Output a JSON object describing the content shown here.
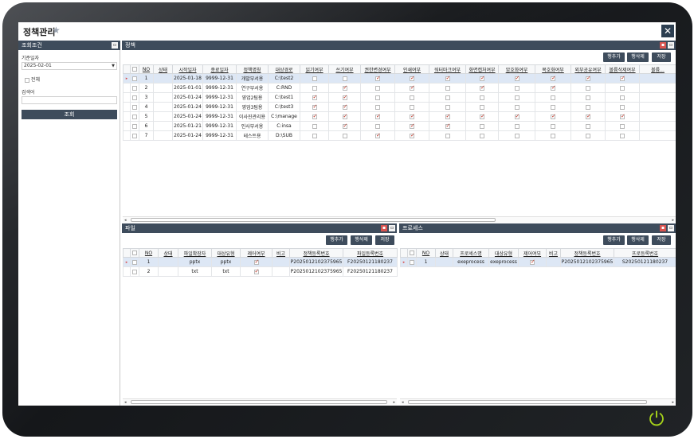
{
  "window": {
    "title": "정책관리",
    "close_label": "✕"
  },
  "left_panel": {
    "header": "조회조건",
    "base_date_label": "기준일자",
    "base_date_value": "2025-02-01",
    "all_label": "전체",
    "search_label": "검색어",
    "search_value": "",
    "search_button": "조회"
  },
  "policy_panel": {
    "header": "정책",
    "buttons": [
      "행추가",
      "행삭제",
      "저장"
    ],
    "columns": [
      "NO",
      "상태",
      "시작일자",
      "종료일자",
      "정책명칭",
      "대상경로",
      "읽기여부",
      "쓰기여부",
      "권한변경여부",
      "인쇄여부",
      "워터마크여부",
      "화면캡처여부",
      "암호화여부",
      "복호화여부",
      "외부공유여부",
      "볼륨삭제여부",
      "볼륨..."
    ],
    "rows": [
      {
        "no": "1",
        "start": "2025-01-18",
        "end": "9999-12-31",
        "name": "개발부서용",
        "path": "C:\\test2",
        "checks": [
          0,
          0,
          1,
          1,
          1,
          1,
          1,
          1,
          1,
          1
        ]
      },
      {
        "no": "2",
        "start": "2025-01-01",
        "end": "9999-12-31",
        "name": "연구부서용",
        "path": "C:RND",
        "checks": [
          0,
          1,
          0,
          1,
          0,
          1,
          0,
          1,
          0,
          0
        ]
      },
      {
        "no": "3",
        "start": "2025-01-24",
        "end": "9999-12-31",
        "name": "영업2팀용",
        "path": "C:\\test1",
        "checks": [
          1,
          1,
          0,
          0,
          0,
          0,
          0,
          0,
          0,
          0
        ]
      },
      {
        "no": "4",
        "start": "2025-01-24",
        "end": "9999-12-31",
        "name": "영업3팀용",
        "path": "C:\\test3",
        "checks": [
          1,
          1,
          0,
          0,
          0,
          0,
          0,
          0,
          0,
          0
        ]
      },
      {
        "no": "5",
        "start": "2025-01-24",
        "end": "9999-12-31",
        "name": "이사진관리용",
        "path": "C:\\manage",
        "checks": [
          1,
          1,
          1,
          1,
          1,
          1,
          1,
          1,
          1,
          1
        ]
      },
      {
        "no": "6",
        "start": "2025-01-21",
        "end": "9999-12-31",
        "name": "인사부서용",
        "path": "C:insa",
        "checks": [
          0,
          1,
          0,
          1,
          1,
          0,
          0,
          0,
          0,
          0
        ]
      },
      {
        "no": "7",
        "start": "2025-01-24",
        "end": "9999-12-31",
        "name": "테스트용",
        "path": "D:\\SUB",
        "checks": [
          0,
          0,
          1,
          1,
          0,
          0,
          0,
          0,
          0,
          0
        ]
      }
    ]
  },
  "file_panel": {
    "header": "파일",
    "buttons": [
      "행추가",
      "행삭제",
      "저장"
    ],
    "columns": [
      "NO",
      "상태",
      "파일확장자",
      "대상유형",
      "제어여부",
      "비고",
      "정책등록번호",
      "파일등록번호"
    ],
    "rows": [
      {
        "no": "1",
        "ext": "pptx",
        "type": "pptx",
        "ctrl": 1,
        "note": "",
        "policy_no": "P2025012102375965",
        "file_no": "F20250121180237"
      },
      {
        "no": "2",
        "ext": "txt",
        "type": "txt",
        "ctrl": 1,
        "note": "",
        "policy_no": "P2025012102375965",
        "file_no": "F20250121180237"
      }
    ]
  },
  "process_panel": {
    "header": "프로세스",
    "buttons": [
      "행추가",
      "행삭제",
      "저장"
    ],
    "columns": [
      "NO",
      "상태",
      "프로세스명",
      "대상유형",
      "제어여부",
      "비고",
      "정책등록번호",
      "프로등록번호"
    ],
    "rows": [
      {
        "no": "1",
        "proc": "exeprocess",
        "type": "exeprocess",
        "ctrl": 1,
        "note": "",
        "policy_no": "P2025012102375965",
        "proc_no": "S20250121180237"
      }
    ]
  }
}
